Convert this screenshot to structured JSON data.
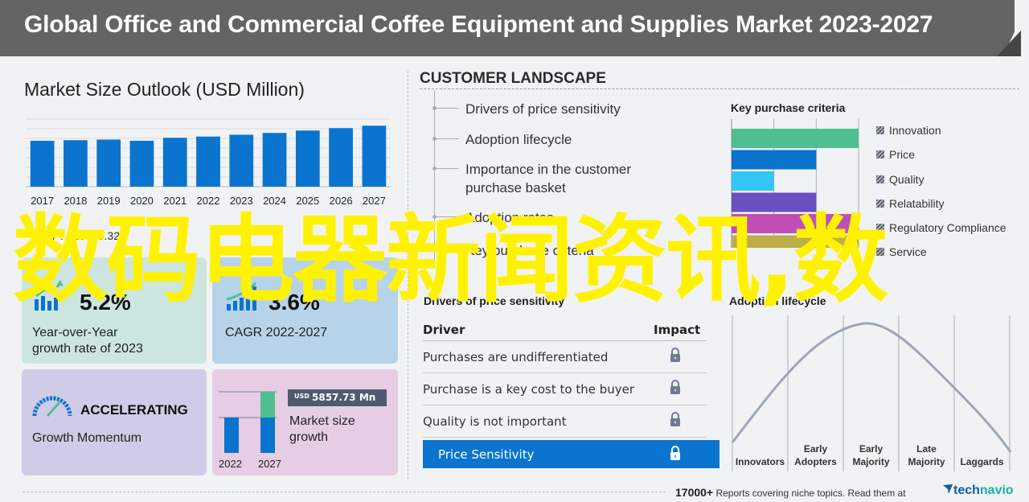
{
  "header": {
    "title": "Global Office and Commercial Coffee Equipment and Supplies Market 2023-2027"
  },
  "market_outlook": {
    "title": "Market Size Outlook (USD Million)",
    "chart_data": {
      "type": "bar",
      "title": "Market Size Outlook (USD Million)",
      "categories": [
        "2017",
        "2018",
        "2019",
        "2020",
        "2021",
        "2022",
        "2023",
        "2024",
        "2025",
        "2026",
        "2027"
      ],
      "values": [
        76,
        77,
        78,
        76,
        81,
        83,
        86,
        89,
        93,
        97,
        101
      ],
      "xlabel": "",
      "ylabel": "",
      "ylim": [
        0,
        112
      ],
      "grid": true,
      "color": "#0a74cf"
    },
    "stat_prefix": "2017 : $16483.32"
  },
  "cards": {
    "yoy": {
      "value": "5.2%",
      "label_line1": "Year-over-Year",
      "label_line2": "growth rate of 2023",
      "color": "#cde5df"
    },
    "cagr": {
      "value": "3.6%",
      "label": "CAGR  2022-2027",
      "color": "#b6d3ea"
    },
    "momentum": {
      "title": "ACCELERATING",
      "label": "Growth Momentum",
      "color": "#d0cbe6"
    },
    "growth": {
      "badge_currency": "USD",
      "badge_amount": "5857.73 Mn",
      "label_line1": "Market size",
      "label_line2": "growth",
      "years": [
        "2022",
        "2027"
      ],
      "color": "#e6cde4"
    }
  },
  "customer_landscape": {
    "title": "CUSTOMER  LANDSCAPE",
    "items": [
      "Drivers of price sensitivity",
      "Adoption lifecycle",
      "Importance in the customer",
      "purchase basket",
      "Adoption rates",
      "Key purchase criteria"
    ]
  },
  "price_sensitivity": {
    "title": "Drivers of price sensitivity",
    "header_driver": "Driver",
    "header_impact": "Impact",
    "rows": [
      "Purchases are undifferentiated",
      "Purchase is a key cost to the buyer",
      "Quality is not important"
    ],
    "highlight_row": "Price Sensitivity"
  },
  "key_purchase_criteria": {
    "title": "Key purchase criteria",
    "chart_data": {
      "type": "bar",
      "orientation": "horizontal",
      "categories": [
        "Innovation",
        "Price",
        "Quality",
        "Relatability",
        "Regulatory Compliance",
        "Service"
      ],
      "values": [
        3,
        2,
        1,
        2,
        3,
        3
      ],
      "xlim": [
        0,
        3
      ],
      "colors": [
        "#4fbf91",
        "#0a74cf",
        "#33c5f3",
        "#6a4fbf",
        "#c050b8",
        "#bdae4a"
      ]
    }
  },
  "adoption_lifecycle": {
    "title": "Adoption lifecycle",
    "chart_data": {
      "type": "line",
      "categories": [
        "Innovators",
        "Early Adopters",
        "Early Majority",
        "Late Majority",
        "Laggards"
      ],
      "category_lines": [
        [
          "Innovators"
        ],
        [
          "Early",
          "Adopters"
        ],
        [
          "Early",
          "Majority"
        ],
        [
          "Late",
          "Majority"
        ],
        [
          "Laggards"
        ]
      ],
      "curve": "bell"
    }
  },
  "footer": {
    "count": "17000+",
    "text": " Reports covering niche topics. Read them at",
    "brand_part1": "tech",
    "brand_part2": "navio"
  },
  "overlay_text": "数码电器新闻资讯,数"
}
